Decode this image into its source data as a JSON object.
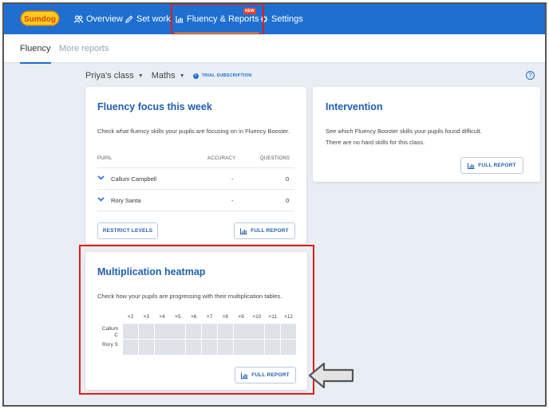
{
  "nav": {
    "logo_text": "Sumdog",
    "items": [
      {
        "label": "Overview",
        "icon": "people-icon"
      },
      {
        "label": "Set work",
        "icon": "pencil-icon"
      },
      {
        "label": "Fluency & Reports",
        "icon": "chart-icon",
        "badge": "NEW",
        "active": true
      },
      {
        "label": "Settings",
        "icon": "gear-icon"
      }
    ]
  },
  "subtabs": [
    {
      "label": "Fluency",
      "active": true
    },
    {
      "label": "More reports",
      "active": false
    }
  ],
  "classbar": {
    "class_name": "Priya's class",
    "subject": "Maths",
    "trial": "TRIAL SUBSCRIPTION"
  },
  "fluency_card": {
    "title": "Fluency focus this week",
    "description": "Check what fluency skills your pupils are focusing on in Fluency Booster.",
    "columns": [
      "PUPIL",
      "ACCURACY",
      "QUESTIONS"
    ],
    "rows": [
      {
        "pupil": "Callum Campbell",
        "accuracy": "-",
        "questions": "0"
      },
      {
        "pupil": "Rory Santa",
        "accuracy": "-",
        "questions": "0"
      }
    ],
    "restrict_label": "RESTRICT LEVELS",
    "report_label": "FULL REPORT"
  },
  "intervention_card": {
    "title": "Intervention",
    "description": "See which Fluency Booster skills your pupils found difficult.",
    "status": "There are no hard skills for this class.",
    "report_label": "FULL REPORT"
  },
  "heatmap_card": {
    "title": "Multiplication heatmap",
    "description": "Check how your pupils are progressing with their multiplication tables.",
    "columns": [
      "×2",
      "×3",
      "×4",
      "×5",
      "×6",
      "×7",
      "×8",
      "×9",
      "×10",
      "×11",
      "×12"
    ],
    "rows": [
      "Callum C",
      "Rory S"
    ],
    "report_label": "FULL REPORT"
  },
  "colors": {
    "nav_bg": "#1f6fd1",
    "accent": "#1f5fb0",
    "highlight": "#e31c1c",
    "heat_cell": "#dfe2e6"
  }
}
